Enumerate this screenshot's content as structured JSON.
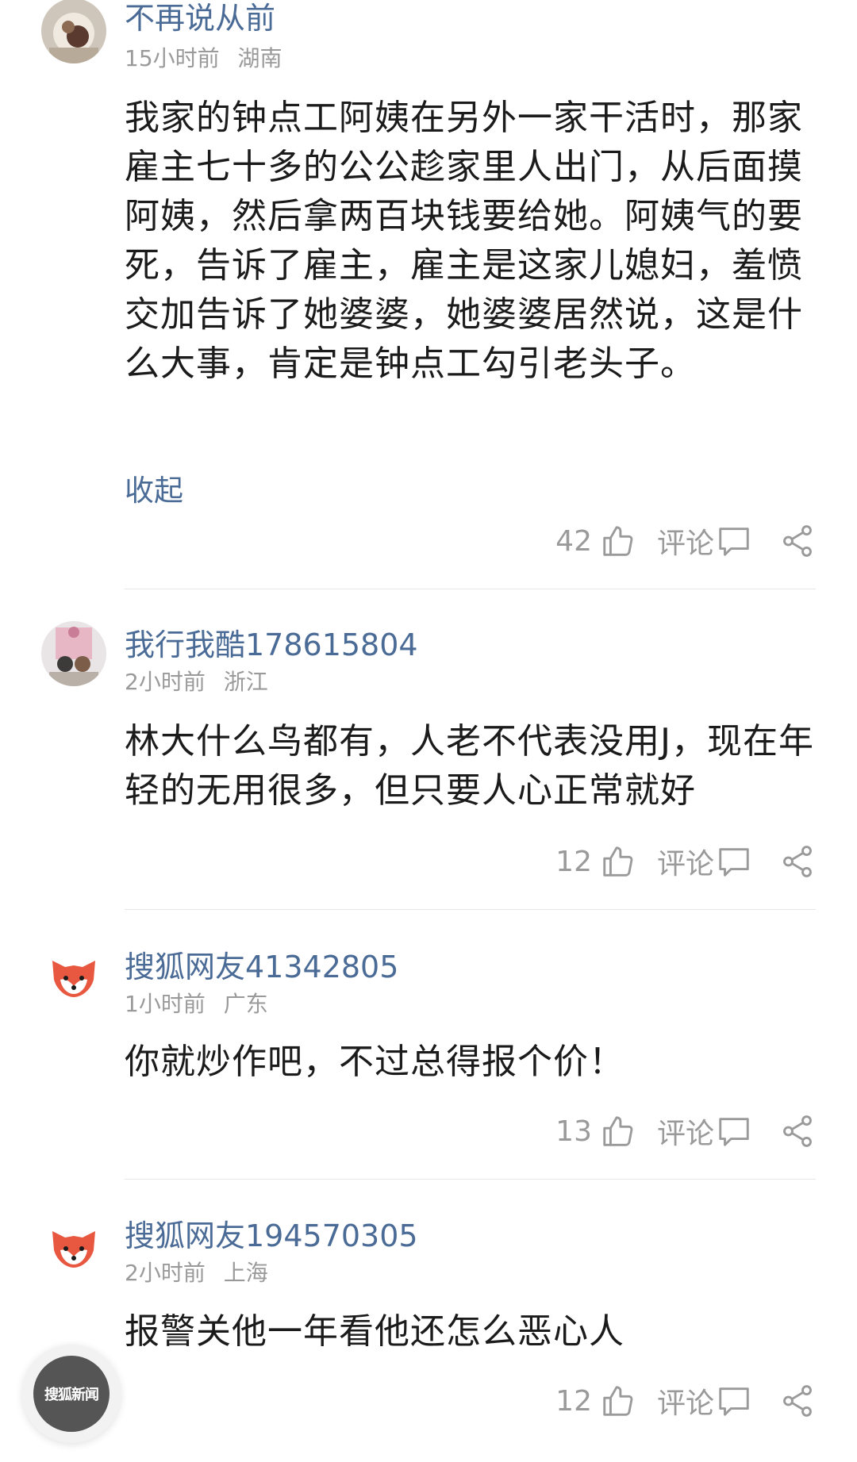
{
  "comments": [
    {
      "username": "不再说从前",
      "time": "15小时前",
      "location": "湖南",
      "text": "我家的钟点工阿姨在另外一家干活时，那家雇主七十多的公公趁家里人出门，从后面摸阿姨，然后拿两百块钱要给她。阿姨气的要死，告诉了雇主，雇主是这家儿媳妇，羞愤交加告诉了她婆婆，她婆婆居然说，这是什么大事，肯定是钟点工勾引老头子。",
      "collapse_label": "收起",
      "likes": "42",
      "comment_label": "评论",
      "avatar_icon": "photo-avatar-icon"
    },
    {
      "username": "我行我酷178615804",
      "time": "2小时前",
      "location": "浙江",
      "text": "林大什么鸟都有，人老不代表没用J，现在年轻的无用很多，但只要人心正常就好",
      "likes": "12",
      "comment_label": "评论",
      "avatar_icon": "photo-avatar-icon"
    },
    {
      "username": "搜狐网友41342805",
      "time": "1小时前",
      "location": "广东",
      "text": "你就炒作吧，不过总得报个价！",
      "likes": "13",
      "comment_label": "评论",
      "avatar_icon": "fox-avatar-icon"
    },
    {
      "username": "搜狐网友194570305",
      "time": "2小时前",
      "location": "上海",
      "text": "报警关他一年看他还怎么恶心人",
      "likes": "12",
      "comment_label": "评论",
      "avatar_icon": "fox-avatar-icon"
    }
  ],
  "watermark": {
    "text": "搜狐新闻"
  },
  "colors": {
    "username": "#4b6b97",
    "meta": "#9a9a9a",
    "text": "#1b1b1b",
    "fox": "#e8573f"
  }
}
